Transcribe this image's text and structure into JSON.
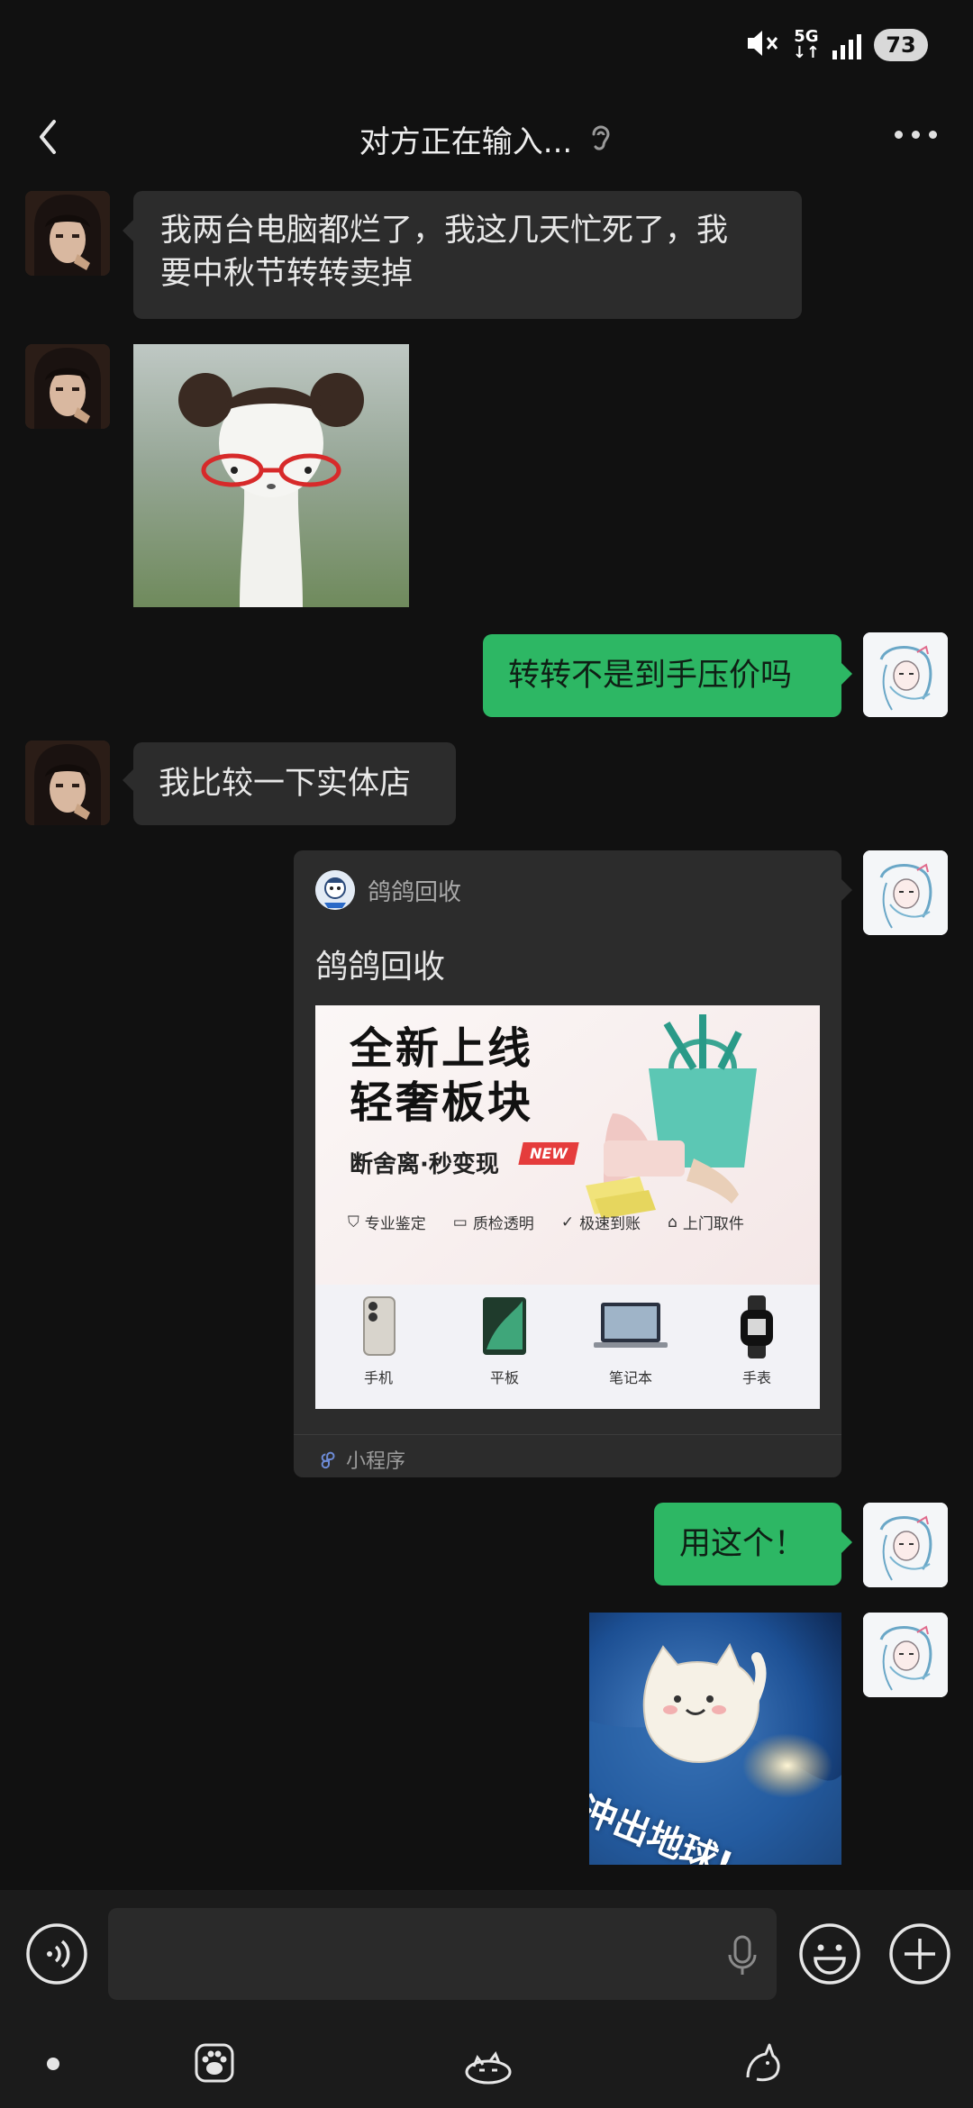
{
  "status_bar": {
    "network_top": "5G",
    "battery": "73"
  },
  "header": {
    "title": "对方正在输入..."
  },
  "messages": [
    {
      "side": "left",
      "type": "text",
      "text_line1": "我两台电脑都烂了，我这几天忙死了，我",
      "text_line2": "要中秋节转转卖掉"
    },
    {
      "side": "left",
      "type": "sticker",
      "sticker": "weasel-with-glasses"
    },
    {
      "side": "right",
      "type": "text",
      "text": "转转不是到手压价吗"
    },
    {
      "side": "left",
      "type": "text",
      "text": "我比较一下实体店"
    },
    {
      "side": "right",
      "type": "mini-program",
      "source": "鸽鸽回收",
      "title": "鸽鸽回收",
      "footer": "小程序"
    },
    {
      "side": "right",
      "type": "text",
      "text": "用这个！"
    },
    {
      "side": "right",
      "type": "sticker",
      "sticker": "cat-rocket",
      "caption": "冲出地球!"
    }
  ],
  "banner": {
    "headline_1": "全新上线",
    "headline_2": "轻奢板块",
    "subline": "断舍离·秒变现",
    "new_tag": "NEW",
    "features": [
      "专业鉴定",
      "质检透明",
      "极速到账",
      "上门取件"
    ],
    "categories": [
      "手机",
      "平板",
      "笔记本",
      "手表"
    ]
  },
  "colors": {
    "background": "#111111",
    "bubble_left": "#2c2c2c",
    "bubble_right": "#2db764"
  },
  "icons": {
    "back": "back-chevron-icon",
    "more": "more-dots-icon",
    "voice": "voice-toggle-icon",
    "emoji": "emoji-icon",
    "plus": "plus-icon",
    "mic": "mic-icon"
  }
}
